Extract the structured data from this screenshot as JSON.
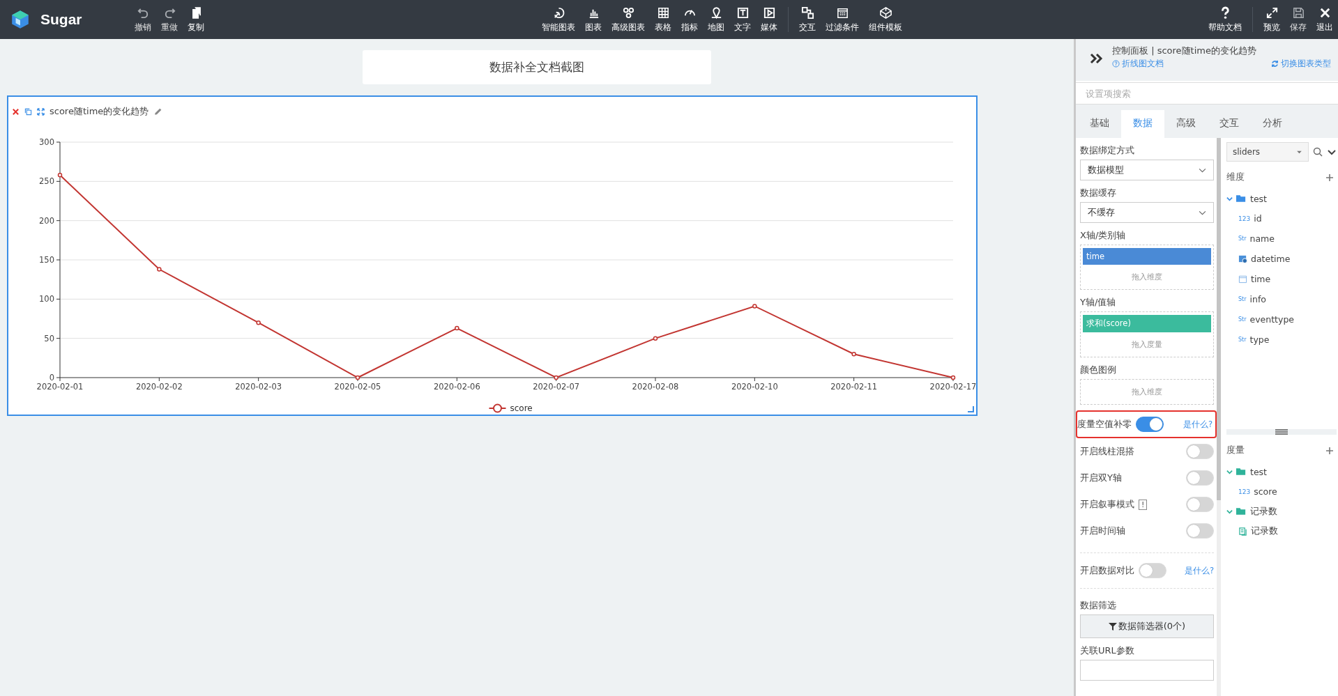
{
  "app": {
    "name": "Sugar"
  },
  "toolbar": {
    "history": [
      {
        "label": "撤销",
        "disabled": true
      },
      {
        "label": "重做",
        "disabled": true
      },
      {
        "label": "复制",
        "disabled": false
      }
    ],
    "components": [
      {
        "label": "智能图表"
      },
      {
        "label": "图表"
      },
      {
        "label": "高级图表"
      },
      {
        "label": "表格"
      },
      {
        "label": "指标"
      },
      {
        "label": "地图"
      },
      {
        "label": "文字"
      },
      {
        "label": "媒体"
      }
    ],
    "logic": [
      {
        "label": "交互"
      },
      {
        "label": "过滤条件"
      },
      {
        "label": "组件模板"
      }
    ],
    "help": {
      "label": "帮助文档"
    },
    "actions": [
      {
        "label": "预览",
        "disabled": false
      },
      {
        "label": "保存",
        "disabled": true
      },
      {
        "label": "退出",
        "disabled": false
      }
    ]
  },
  "canvas": {
    "page_title": "数据补全文档截图",
    "chart": {
      "title": "score随time的变化趋势",
      "chart_data": {
        "type": "line",
        "categories": [
          "2020-02-01",
          "2020-02-02",
          "2020-02-03",
          "2020-02-05",
          "2020-02-06",
          "2020-02-07",
          "2020-02-08",
          "2020-02-10",
          "2020-02-11",
          "2020-02-17"
        ],
        "ylim": [
          0,
          300
        ],
        "grid": true,
        "yticks": [
          0,
          50,
          100,
          150,
          200,
          250,
          300
        ],
        "series": [
          {
            "name": "score",
            "color": "#c23531",
            "marker": true,
            "values": [
              258,
              138,
              70,
              0,
              63,
              0,
              50,
              91,
              30,
              0
            ]
          }
        ]
      }
    }
  },
  "panel": {
    "title": "控制面板 | score随time的变化趋势",
    "doc_link": "折线图文档",
    "switch_link": "切换图表类型",
    "search": {
      "placeholder": "设置项搜索"
    },
    "tabs": [
      {
        "label": "基础",
        "selected": false
      },
      {
        "label": "数据",
        "selected": true
      },
      {
        "label": "高级",
        "selected": false
      },
      {
        "label": "交互",
        "selected": false
      },
      {
        "label": "分析",
        "selected": false
      }
    ],
    "settings": {
      "binding": {
        "label": "数据绑定方式",
        "value": "数据模型"
      },
      "cache": {
        "label": "数据缓存",
        "value": "不缓存"
      },
      "dropzones": [
        {
          "label": "X轴/类别轴",
          "chips": [
            {
              "text": "time",
              "kind": "dimension"
            }
          ],
          "hint": "拖入维度"
        },
        {
          "label": "Y轴/值轴",
          "chips": [
            {
              "text": "求和(score)",
              "kind": "measure"
            }
          ],
          "hint": "拖入度量"
        },
        {
          "label": "颜色图例",
          "hint": "拖入维度"
        }
      ],
      "toggles": [
        {
          "label": "度量空值补零",
          "on": true,
          "help": "是什么?",
          "highlighted": true
        },
        {
          "label": "开启线柱混搭",
          "on": false,
          "highlighted": false
        },
        {
          "label": "开启双Y轴",
          "on": false,
          "highlighted": false
        },
        {
          "label": "开启叙事模式",
          "on": false,
          "badge": "!",
          "highlighted": false
        },
        {
          "label": "开启时间轴",
          "on": false,
          "highlighted": false
        },
        {
          "label": "开启数据对比",
          "on": false,
          "help": "是什么?",
          "highlighted": false
        }
      ],
      "filter": {
        "label": "数据筛选",
        "button": "数据筛选器(0个)"
      },
      "url_params": {
        "label": "关联URL参数"
      }
    },
    "fields": {
      "source": "sliders",
      "dimensions": {
        "label": "维度",
        "groups": [
          {
            "name": "test",
            "expanded": true,
            "children": [
              {
                "name": "id",
                "kind": "number",
                "badge": "123"
              },
              {
                "name": "name",
                "kind": "string",
                "badge": "Str"
              },
              {
                "name": "datetime",
                "kind": "datetime"
              },
              {
                "name": "time",
                "kind": "date"
              },
              {
                "name": "info",
                "kind": "string",
                "badge": "Str"
              },
              {
                "name": "eventtype",
                "kind": "string",
                "badge": "Str"
              },
              {
                "name": "type",
                "kind": "string",
                "badge": "Str"
              }
            ]
          }
        ]
      },
      "measures": {
        "label": "度量",
        "groups": [
          {
            "name": "test",
            "expanded": true,
            "children": [
              {
                "name": "score",
                "kind": "number",
                "badge": "123"
              }
            ]
          },
          {
            "name": "记录数",
            "expanded": true,
            "children": [
              {
                "name": "记录数",
                "kind": "count"
              }
            ]
          }
        ]
      }
    }
  }
}
